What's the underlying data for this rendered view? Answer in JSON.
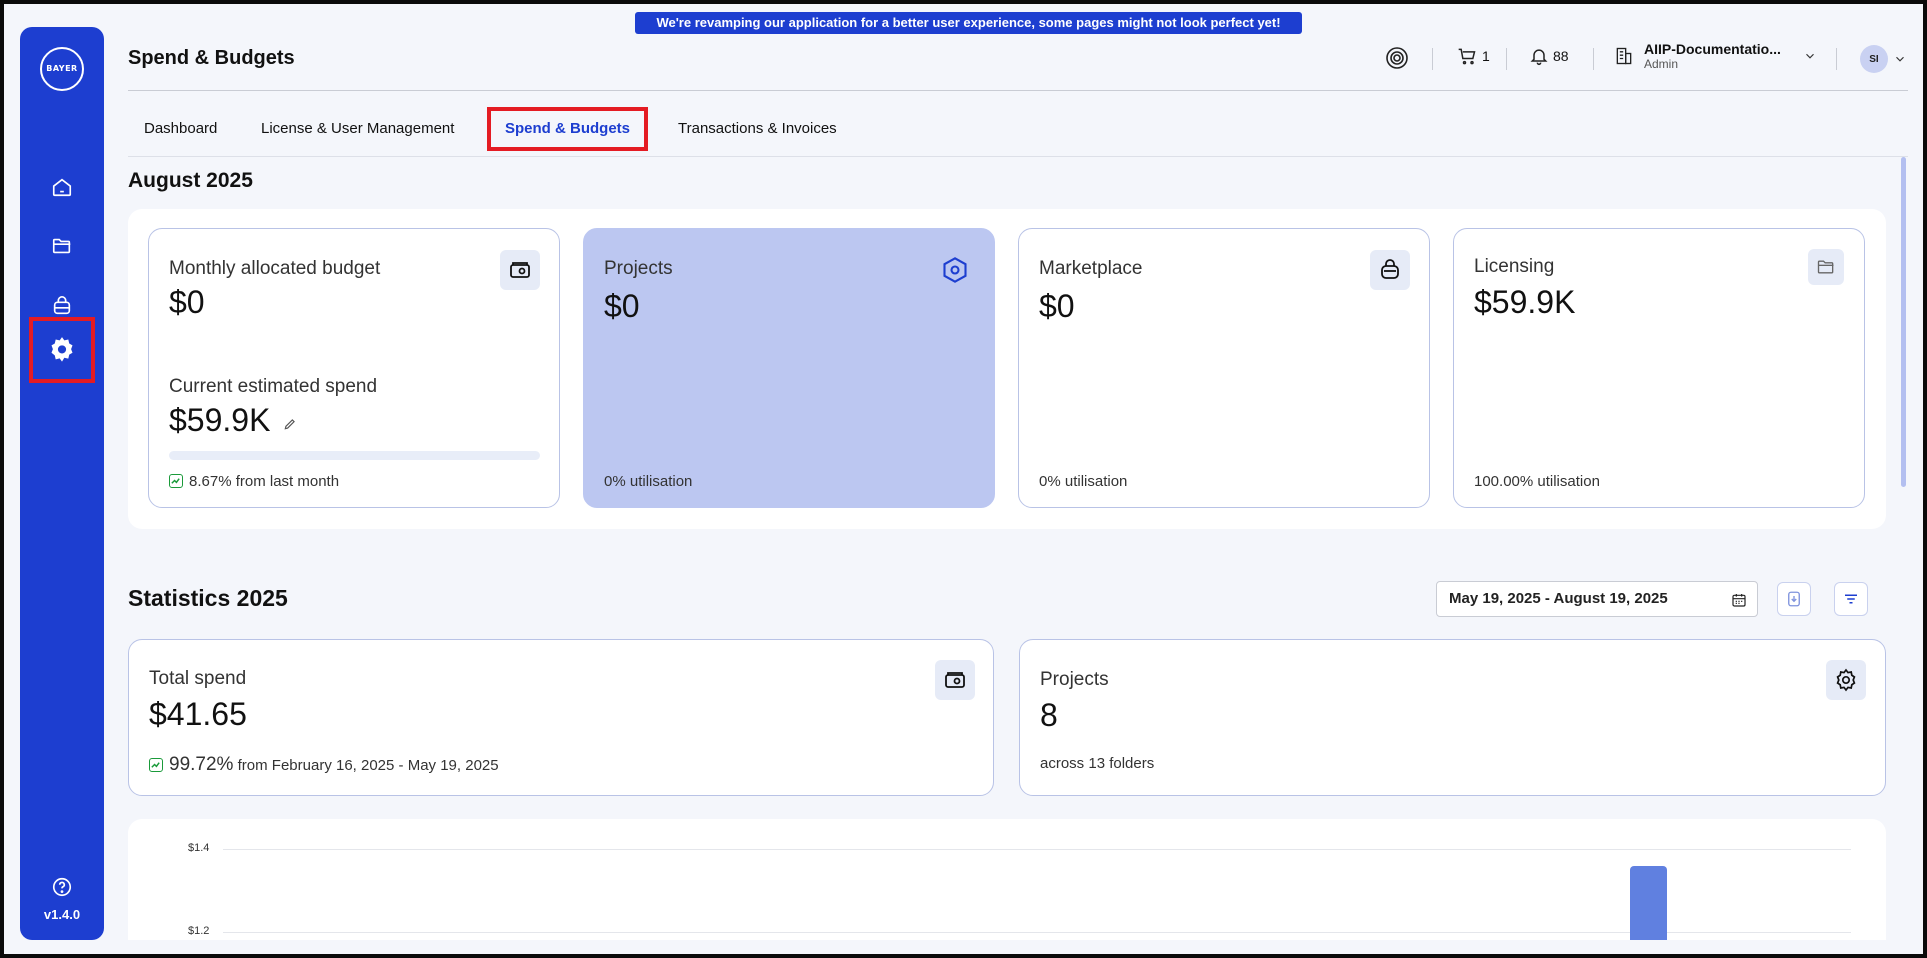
{
  "banner": "We're revamping our application for a better user experience, some pages might not look perfect yet!",
  "sidebar": {
    "logo_h": "BAYER",
    "logo_v": "BAYER",
    "items": [
      "home-icon",
      "folder-icon",
      "bag-icon",
      "settings-icon"
    ],
    "version": "v1.4.0"
  },
  "header": {
    "title": "Spend & Budgets",
    "cart_count": "1",
    "notifications_count": "88",
    "org_name": "AIIP-Documentatio...",
    "org_role": "Admin",
    "avatar_initials": "SI"
  },
  "tabs": [
    "Dashboard",
    "License & User Management",
    "Spend & Budgets",
    "Transactions & Invoices"
  ],
  "budget": {
    "section_title": "August 2025",
    "monthly_label": "Monthly allocated budget",
    "monthly_value": "$0",
    "current_label": "Current estimated spend",
    "current_value": "$59.9K",
    "progress_fraction": 0.0,
    "trend_text": "8.67% from last month",
    "projects_label": "Projects",
    "projects_value": "$0",
    "projects_util": "0% utilisation",
    "marketplace_label": "Marketplace",
    "marketplace_value": "$0",
    "marketplace_util": "0% utilisation",
    "licensing_label": "Licensing",
    "licensing_value": "$59.9K",
    "licensing_util": "100.00% utilisation"
  },
  "statistics": {
    "section_title": "Statistics 2025",
    "date_range": "May 19, 2025 - August 19, 2025",
    "total_label": "Total spend",
    "total_value": "$41.65",
    "total_pct": "99.72%",
    "total_from": "from February 16, 2025 - May 19, 2025",
    "projects_label": "Projects",
    "projects_value": "8",
    "projects_foot": "across 13 folders"
  },
  "chart_data": {
    "type": "bar",
    "y_ticks": [
      "$1.4",
      "$1.2"
    ],
    "values_visible": [
      {
        "category_index": 0,
        "value": 1.36
      }
    ],
    "colors": {
      "bar": "#6080e0"
    }
  },
  "colors": {
    "accent": "#1d3ed0",
    "highlight_card": "#bcc7f1",
    "annotation": "#e41b23"
  }
}
